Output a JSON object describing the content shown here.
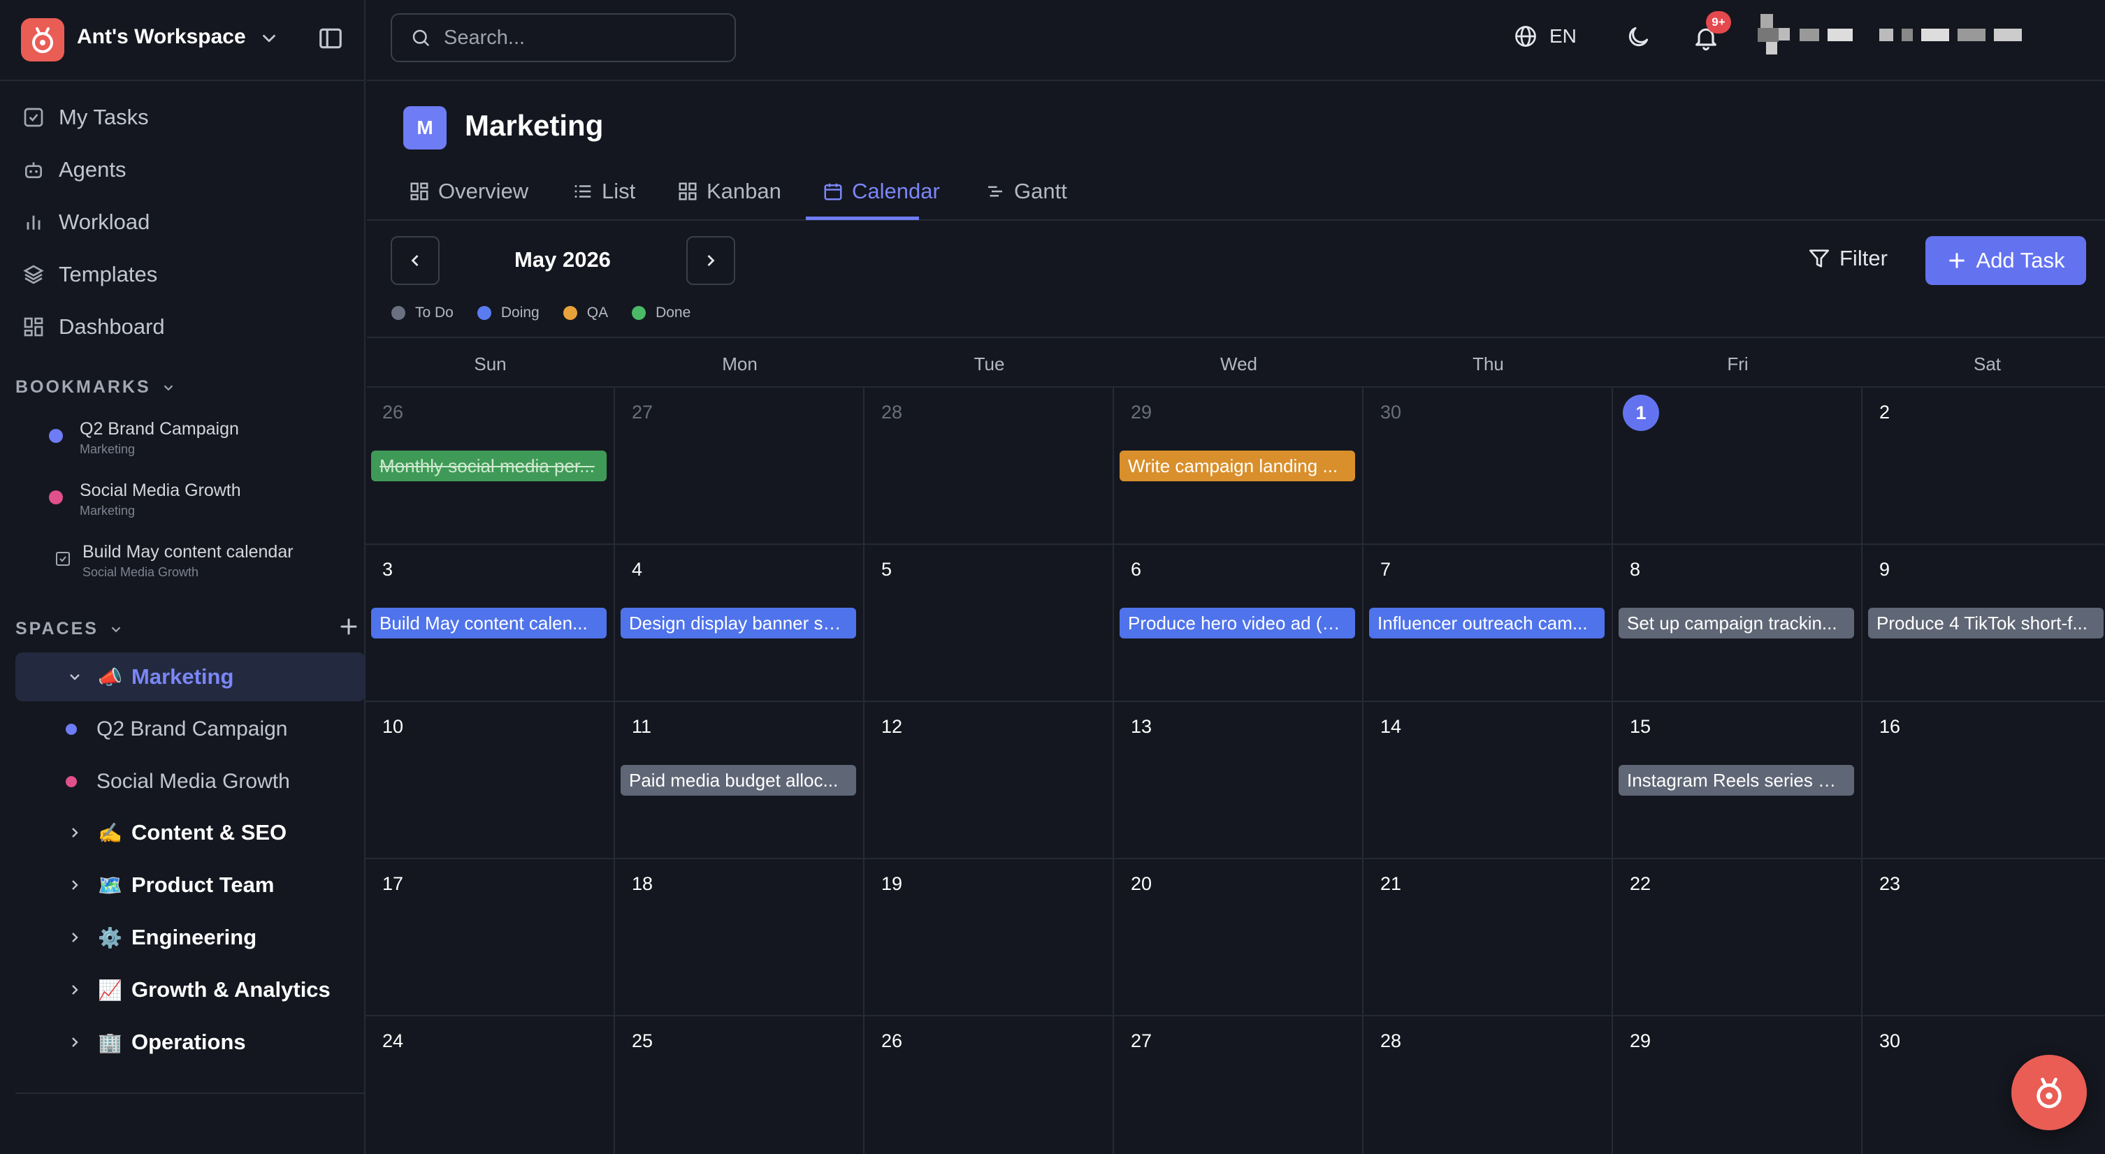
{
  "workspace": {
    "name": "Ant's Workspace"
  },
  "nav": [
    {
      "label": "My Tasks",
      "icon": "checkbox-icon"
    },
    {
      "label": "Agents",
      "icon": "robot-icon"
    },
    {
      "label": "Workload",
      "icon": "bar-chart-icon"
    },
    {
      "label": "Templates",
      "icon": "layers-icon"
    },
    {
      "label": "Dashboard",
      "icon": "grid-icon"
    }
  ],
  "bookmarks": {
    "header": "BOOKMARKS",
    "items": [
      {
        "title": "Q2 Brand Campaign",
        "subtitle": "Marketing",
        "color": "#6e7cf5"
      },
      {
        "title": "Social Media Growth",
        "subtitle": "Marketing",
        "color": "#e0508a"
      },
      {
        "title": "Build May content calendar",
        "subtitle": "Social Media Growth"
      }
    ]
  },
  "spaces": {
    "header": "SPACES",
    "active": {
      "emoji": "📣",
      "name": "Marketing"
    },
    "sub": [
      {
        "name": "Q2 Brand Campaign",
        "color": "#6e7cf5"
      },
      {
        "name": "Social Media Growth",
        "color": "#e0508a"
      }
    ],
    "others": [
      {
        "emoji": "✍️",
        "name": "Content & SEO"
      },
      {
        "emoji": "🗺️",
        "name": "Product Team"
      },
      {
        "emoji": "⚙️",
        "name": "Engineering"
      },
      {
        "emoji": "📈",
        "name": "Growth & Analytics"
      },
      {
        "emoji": "🏢",
        "name": "Operations"
      }
    ]
  },
  "topbar": {
    "search_placeholder": "Search...",
    "language": "EN",
    "notifications_badge": "9+"
  },
  "project": {
    "badge": "M",
    "title": "Marketing",
    "tabs": [
      {
        "label": "Overview",
        "icon": "overview-icon"
      },
      {
        "label": "List",
        "icon": "list-icon"
      },
      {
        "label": "Kanban",
        "icon": "kanban-icon"
      },
      {
        "label": "Calendar",
        "icon": "calendar-icon",
        "active": true
      },
      {
        "label": "Gantt",
        "icon": "gantt-icon"
      }
    ]
  },
  "calendar": {
    "month_label": "May 2026",
    "filter_label": "Filter",
    "add_task_label": "Add Task",
    "legend": [
      {
        "label": "To Do",
        "color": "#6b7180"
      },
      {
        "label": "Doing",
        "color": "#5b7cf0"
      },
      {
        "label": "QA",
        "color": "#e8a23a"
      },
      {
        "label": "Done",
        "color": "#4cb968"
      }
    ],
    "weekdays": [
      "Sun",
      "Mon",
      "Tue",
      "Wed",
      "Thu",
      "Fri",
      "Sat"
    ],
    "weeks": [
      [
        {
          "day": "26",
          "outside": true,
          "event": {
            "title": "Monthly social media per...",
            "status": "done"
          }
        },
        {
          "day": "27",
          "outside": true
        },
        {
          "day": "28",
          "outside": true
        },
        {
          "day": "29",
          "outside": true,
          "event": {
            "title": "Write campaign landing ...",
            "status": "qa"
          }
        },
        {
          "day": "30",
          "outside": true
        },
        {
          "day": "1",
          "today": true
        },
        {
          "day": "2"
        }
      ],
      [
        {
          "day": "3",
          "event": {
            "title": "Build May content calen...",
            "status": "doing"
          }
        },
        {
          "day": "4",
          "event": {
            "title": "Design display banner se...",
            "status": "doing"
          }
        },
        {
          "day": "5"
        },
        {
          "day": "6",
          "event": {
            "title": "Produce hero video ad (3...",
            "status": "doing"
          }
        },
        {
          "day": "7",
          "event": {
            "title": "Influencer outreach cam...",
            "status": "doing"
          }
        },
        {
          "day": "8",
          "event": {
            "title": "Set up campaign trackin...",
            "status": "todo"
          }
        },
        {
          "day": "9",
          "event": {
            "title": "Produce 4 TikTok short-f...",
            "status": "todo"
          }
        }
      ],
      [
        {
          "day": "10"
        },
        {
          "day": "11",
          "event": {
            "title": "Paid media budget alloc...",
            "status": "todo"
          }
        },
        {
          "day": "12"
        },
        {
          "day": "13"
        },
        {
          "day": "14"
        },
        {
          "day": "15",
          "event": {
            "title": "Instagram Reels series —...",
            "status": "todo"
          }
        },
        {
          "day": "16"
        }
      ],
      [
        {
          "day": "17"
        },
        {
          "day": "18"
        },
        {
          "day": "19"
        },
        {
          "day": "20"
        },
        {
          "day": "21"
        },
        {
          "day": "22"
        },
        {
          "day": "23"
        }
      ],
      [
        {
          "day": "24"
        },
        {
          "day": "25"
        },
        {
          "day": "26"
        },
        {
          "day": "27"
        },
        {
          "day": "28"
        },
        {
          "day": "29"
        },
        {
          "day": "30"
        }
      ]
    ],
    "status_colors": {
      "todo": "#5f6675",
      "doing": "#4f73ea",
      "qa": "#d98f2b",
      "done": "#3f9a57"
    }
  }
}
